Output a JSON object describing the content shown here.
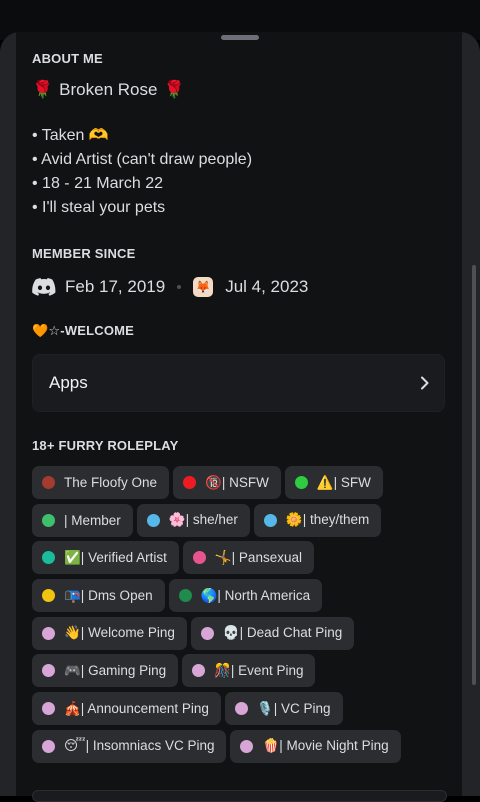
{
  "about": {
    "title": "ABOUT ME",
    "name_left_emoji": "🌹",
    "name": "Broken Rose",
    "name_right_emoji": "🌹",
    "bio_lines": [
      "• Taken 🫶",
      "• Avid Artist (can't draw people)",
      "• 18 - 21 March 22",
      "• I'll steal your pets"
    ]
  },
  "member_since": {
    "title": "MEMBER SINCE",
    "discord_date": "Feb 17, 2019",
    "server_icon": "🦊",
    "server_date": "Jul 4, 2023"
  },
  "welcome": {
    "title": "🧡☆-WELCOME"
  },
  "apps": {
    "label": "Apps",
    "chevron_icon": "chevron-right-icon"
  },
  "roles_section": {
    "title": "18+ FURRY ROLEPLAY",
    "rows": [
      [
        {
          "label": "The Floofy One",
          "color": "#a33b2e"
        },
        {
          "label": "🔞| NSFW",
          "color": "#ed1c24"
        },
        {
          "label": "⚠️| SFW",
          "color": "#2ecc40"
        }
      ],
      [
        {
          "label": "| Member",
          "color": "#3fbf6e"
        },
        {
          "label": "🌸| she/her",
          "color": "#55b8e8"
        },
        {
          "label": "🌼| they/them",
          "color": "#55b8e8"
        }
      ],
      [
        {
          "label": "✅| Verified Artist",
          "color": "#1abc9c"
        },
        {
          "label": "🤸| Pansexual",
          "color": "#e8548f"
        }
      ],
      [
        {
          "label": "📭| Dms Open",
          "color": "#f1c40f"
        },
        {
          "label": "🌎| North America",
          "color": "#1f8b4c"
        }
      ],
      [
        {
          "label": "👋| Welcome Ping",
          "color": "#d7a5d6"
        },
        {
          "label": "💀| Dead Chat Ping",
          "color": "#d7a5d6"
        }
      ],
      [
        {
          "label": "🎮| Gaming Ping",
          "color": "#d7a5d6"
        },
        {
          "label": "🎊| Event Ping",
          "color": "#d7a5d6"
        }
      ],
      [
        {
          "label": "🎪| Announcement Ping",
          "color": "#d7a5d6"
        },
        {
          "label": "🎙️| VC Ping",
          "color": "#d7a5d6"
        }
      ],
      [
        {
          "label": "😴| Insomniacs VC Ping",
          "color": "#d7a5d6"
        },
        {
          "label": "🍿| Movie Night Ping",
          "color": "#d7a5d6"
        }
      ]
    ]
  }
}
